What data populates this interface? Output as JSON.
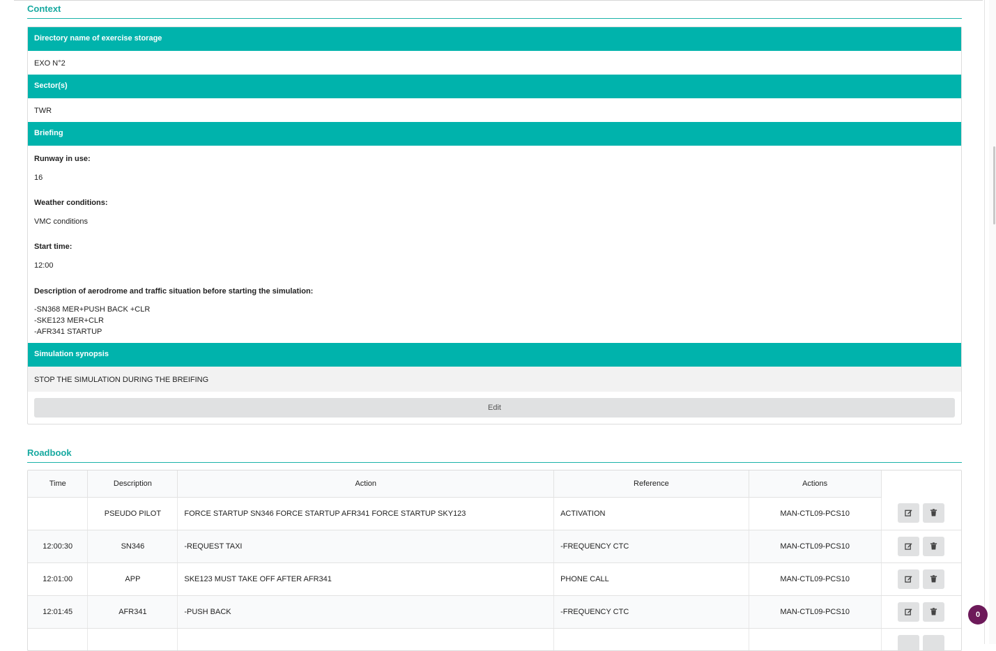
{
  "context": {
    "title": "Context",
    "directory": {
      "label": "Directory name of exercise storage",
      "value": "EXO N°2"
    },
    "sectors": {
      "label": "Sector(s)",
      "value": "TWR"
    },
    "briefing": {
      "label": "Briefing",
      "runway_label": "Runway in use:",
      "runway_value": "16",
      "weather_label": "Weather conditions:",
      "weather_value": "VMC conditions",
      "start_label": "Start time:",
      "start_value": "12:00",
      "description_label": "Description of aerodrome and traffic situation before starting the simulation:",
      "description_lines": [
        "-SN368 MER+PUSH BACK +CLR",
        "-SKE123 MER+CLR",
        "-AFR341 STARTUP"
      ]
    },
    "synopsis": {
      "label": "Simulation synopsis",
      "value": "STOP THE SIMULATION DURING THE BREIFING"
    },
    "edit_label": "Edit"
  },
  "roadbook": {
    "title": "Roadbook",
    "columns": [
      "Time",
      "Description",
      "Action",
      "Reference",
      "Actions"
    ],
    "rows": [
      {
        "time": "",
        "description": "PSEUDO PILOT",
        "action": "FORCE STARTUP SN346 FORCE STARTUP AFR341 FORCE STARTUP SKY123",
        "reference": "ACTIVATION",
        "actions": "MAN-CTL09-PCS10"
      },
      {
        "time": "12:00:30",
        "description": "SN346",
        "action": "-REQUEST TAXI",
        "reference": "-FREQUENCY CTC",
        "actions": "MAN-CTL09-PCS10"
      },
      {
        "time": "12:01:00",
        "description": "APP",
        "action": "SKE123 MUST TAKE OFF AFTER AFR341",
        "reference": "PHONE CALL",
        "actions": "MAN-CTL09-PCS10"
      },
      {
        "time": "12:01:45",
        "description": "AFR341",
        "action": "-PUSH BACK",
        "reference": "-FREQUENCY CTC",
        "actions": "MAN-CTL09-PCS10"
      }
    ]
  },
  "notification_count": "0",
  "colors": {
    "accent": "#00b3ac",
    "title": "#17a9a0",
    "badge": "#6d1a5a"
  }
}
